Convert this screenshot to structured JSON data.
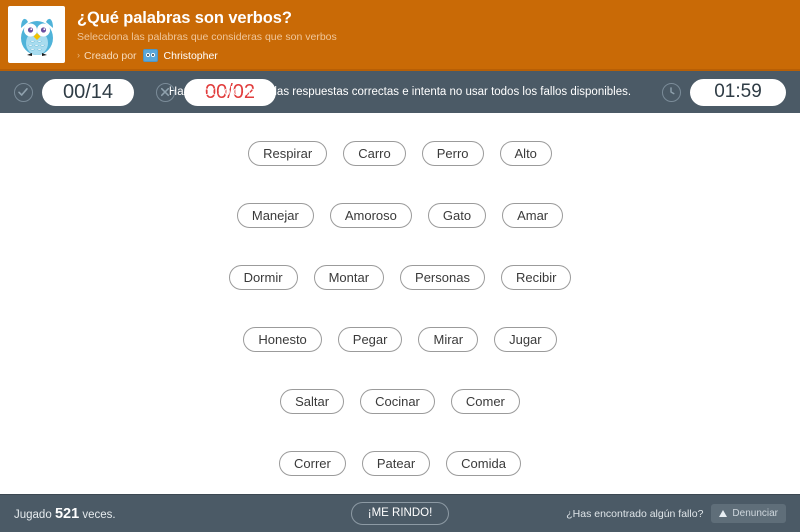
{
  "header": {
    "logo_icon": "owl-logo",
    "title": "¿Qué palabras son verbos?",
    "subtitle": "Selecciona las palabras que consideras que son verbos",
    "creator_prefix": "Creado por",
    "creator_name": "Christopher",
    "chevron": "›",
    "colors": {
      "background": "#c96a06",
      "title": "#ffffff"
    }
  },
  "stats": {
    "correct_icon": "check-circle-icon",
    "correct_value": "00/14",
    "wrong_icon": "x-circle-icon",
    "wrong_value": "00/02",
    "wrong_color": "#e13c3c",
    "instructions": "Haz click solo sobre las respuestas correctas e intenta no usar todos los fallos disponibles.",
    "timer_icon": "clock-icon",
    "timer_value": "01:59",
    "bar_color": "#4b5a66"
  },
  "board": {
    "rows": [
      {
        "words": [
          "Respirar",
          "Carro",
          "Perro",
          "Alto"
        ]
      },
      {
        "words": [
          "Manejar",
          "Amoroso",
          "Gato",
          "Amar"
        ]
      },
      {
        "words": [
          "Dormir",
          "Montar",
          "Personas",
          "Recibir"
        ]
      },
      {
        "words": [
          "Honesto",
          "Pegar",
          "Mirar",
          "Jugar"
        ]
      },
      {
        "words": [
          "Saltar",
          "Cocinar",
          "Comer"
        ]
      },
      {
        "words": [
          "Correr",
          "Patear",
          "Comida"
        ]
      }
    ]
  },
  "footer": {
    "played_prefix": "Jugado",
    "played_count": "521",
    "played_suffix": "veces.",
    "surrender_label": "¡ME RINDO!",
    "report_question": "¿Has encontrado algún fallo?",
    "report_icon": "warning-triangle-icon",
    "report_label": "Denunciar"
  }
}
